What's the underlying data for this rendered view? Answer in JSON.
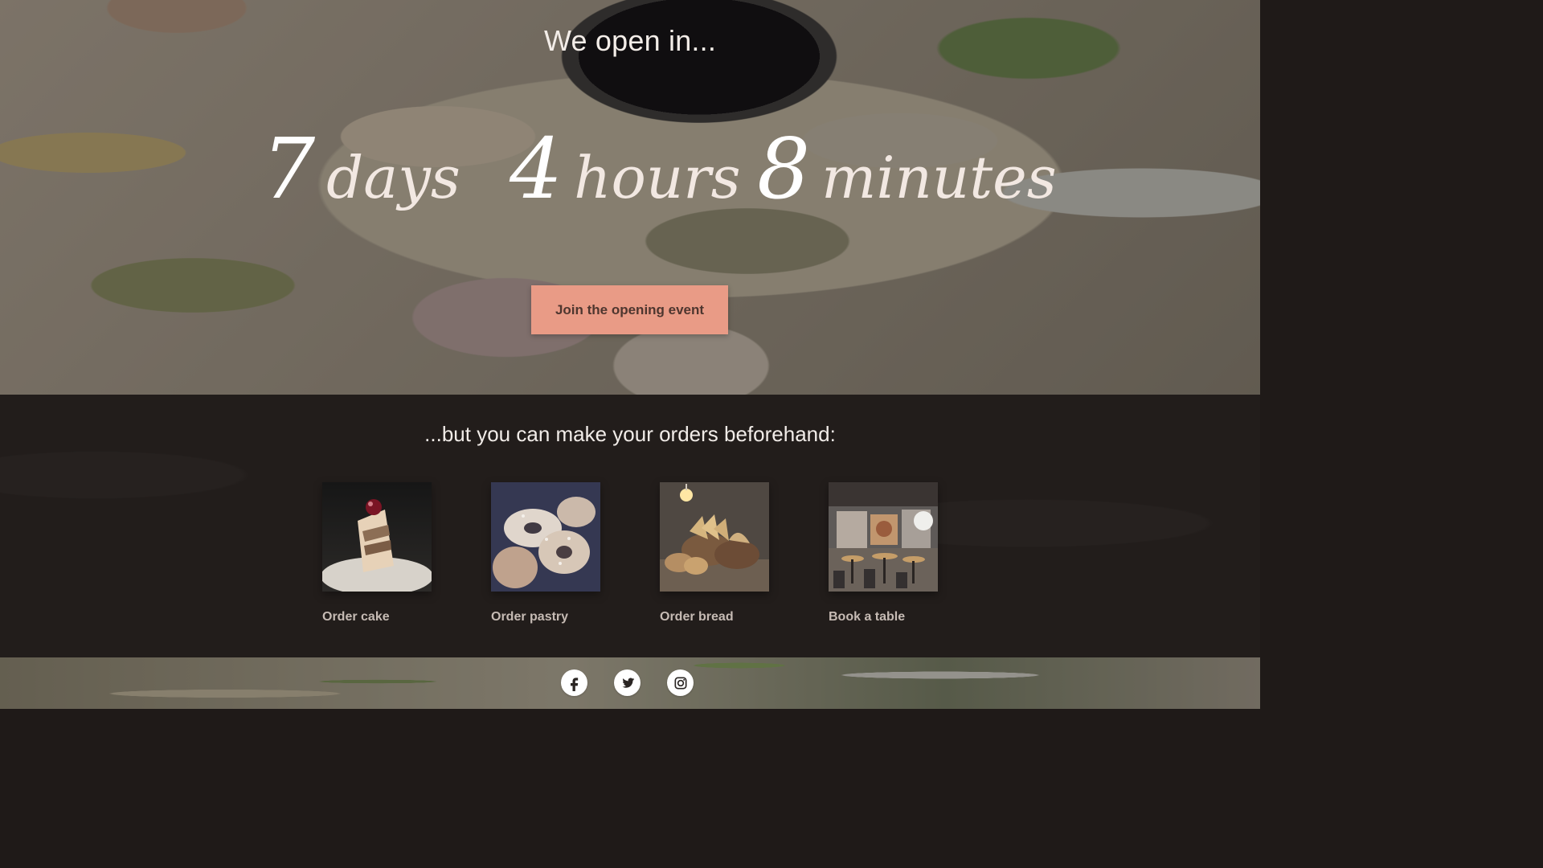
{
  "hero": {
    "subtitle": "We open in...",
    "countdown": [
      {
        "value": "7",
        "unit": "days"
      },
      {
        "value": "4",
        "unit": "hours"
      },
      {
        "value": "8",
        "unit": "minutes"
      }
    ],
    "cta_label": "Join the opening event"
  },
  "orders": {
    "title": "...but you can make your orders beforehand:",
    "items": [
      {
        "label": "Order cake"
      },
      {
        "label": "Order pastry"
      },
      {
        "label": "Order bread"
      },
      {
        "label": "Book a table"
      }
    ]
  },
  "footer": {
    "social_links": [
      {
        "icon": "facebook-icon"
      },
      {
        "icon": "twitter-icon"
      },
      {
        "icon": "instagram-icon"
      }
    ]
  },
  "colors": {
    "accent": "#e99b86",
    "dark_band": "#221d1b",
    "text_light": "#f1ece8",
    "card_label": "#c6bbb4"
  }
}
